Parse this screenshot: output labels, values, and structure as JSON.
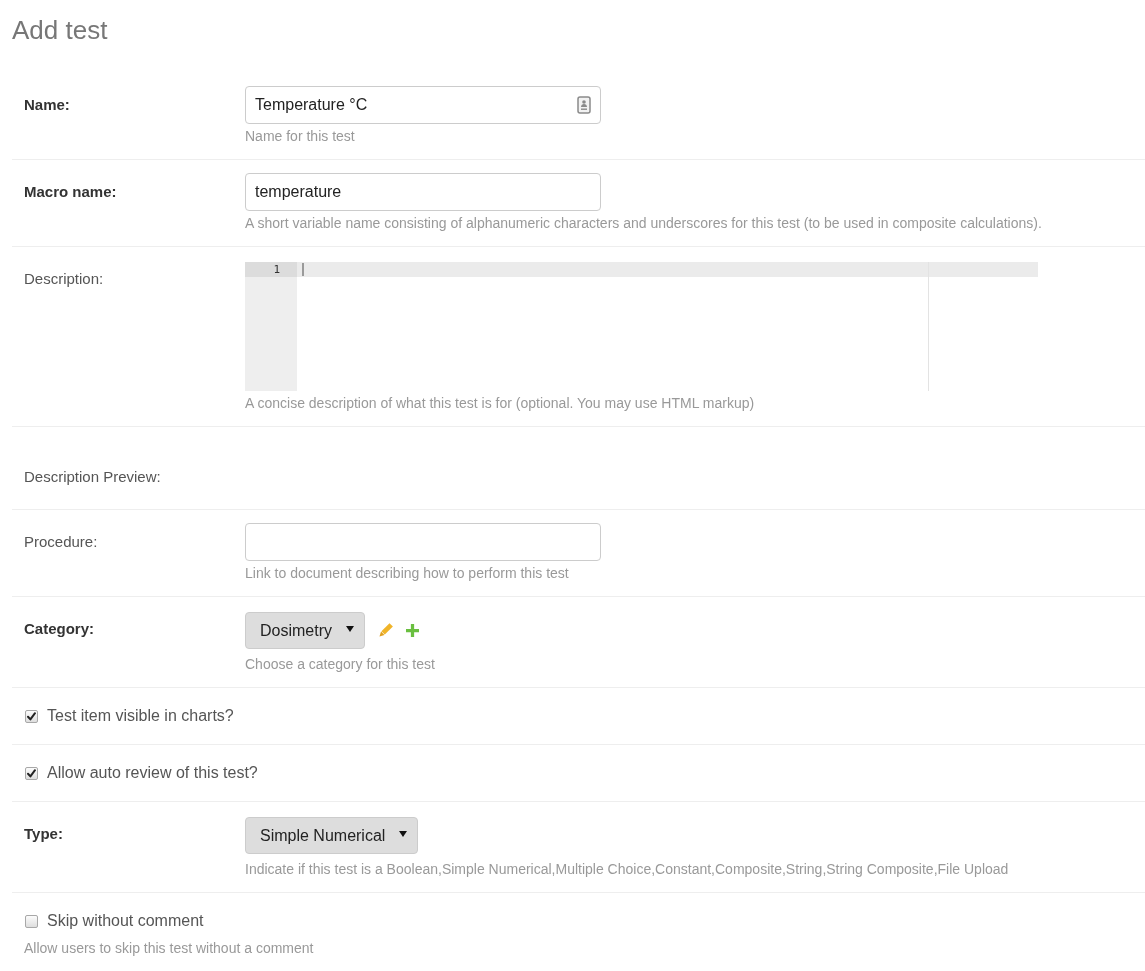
{
  "title": "Add test",
  "fields": [
    {
      "kind": "text",
      "label": "Name:",
      "required": true,
      "value": "Temperature °C",
      "autofill_icon": true,
      "help": "Name for this test"
    },
    {
      "kind": "text",
      "label": "Macro name:",
      "required": true,
      "value": "temperature",
      "autofill_icon": false,
      "help": "A short variable name consisting of alphanumeric characters and underscores for this test (to be used in composite calculations)."
    },
    {
      "kind": "code",
      "label": "Description:",
      "required": false,
      "line_numbers": [
        "1"
      ],
      "focused": true,
      "help": "A concise description of what this test is for (optional. You may use HTML markup)"
    },
    {
      "kind": "preview",
      "label": "Description Preview:",
      "required": false
    },
    {
      "kind": "text",
      "label": "Procedure:",
      "required": false,
      "autofill_icon": false,
      "help": "Link to document describing how to perform this test"
    },
    {
      "kind": "select",
      "label": "Category:",
      "required": true,
      "value": "Dosimetry",
      "actions": true,
      "help": "Choose a category for this test"
    },
    {
      "kind": "checkbox",
      "label": "Test item visible in charts?",
      "checked": true
    },
    {
      "kind": "checkbox",
      "label": "Allow auto review of this test?",
      "checked": true
    },
    {
      "kind": "select",
      "label": "Type:",
      "required": true,
      "value": "Simple Numerical",
      "actions": false,
      "help": "Indicate if this test is a Boolean,Simple Numerical,Multiple Choice,Constant,Composite,String,String Composite,File Upload"
    },
    {
      "kind": "checkbox",
      "label": "Skip without comment",
      "checked": false,
      "help": "Allow users to skip this test without a comment"
    }
  ]
}
